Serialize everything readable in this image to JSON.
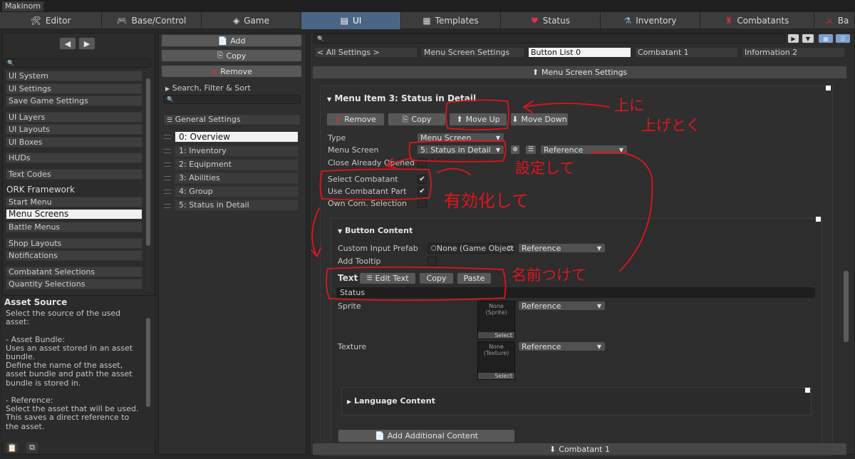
{
  "app": {
    "title": "Makinom"
  },
  "tabs": [
    {
      "label": "Editor",
      "icon": "wrench-icon"
    },
    {
      "label": "Base/Control",
      "icon": "gamepad-icon"
    },
    {
      "label": "Game",
      "icon": "cube-icon"
    },
    {
      "label": "UI",
      "icon": "ui-window-icon"
    },
    {
      "label": "Templates",
      "icon": "document-icon"
    },
    {
      "label": "Status",
      "icon": "heart-icon"
    },
    {
      "label": "Inventory",
      "icon": "potion-icon"
    },
    {
      "label": "Combatants",
      "icon": "warrior-icon"
    },
    {
      "label": "Ba",
      "icon": "swords-icon"
    }
  ],
  "sidebar": {
    "groups": [
      {
        "items": [
          "UI System",
          "UI Settings",
          "Save Game Settings"
        ]
      },
      {
        "items": [
          "UI Layers",
          "UI Layouts",
          "UI Boxes"
        ]
      },
      {
        "items": [
          "HUDs"
        ]
      },
      {
        "items": [
          "Text Codes"
        ]
      }
    ],
    "ork_header": "ORK Framework",
    "ork_items": [
      "Start Menu",
      "Menu Screens",
      "Battle Menus",
      "Shop Layouts",
      "Notifications",
      "Combatant Selections",
      "Quantity Selections"
    ],
    "selected": "Menu Screens"
  },
  "help": {
    "title": "Asset Source",
    "text": "Select the source of the used asset:\n\n- Asset Bundle:\nUses an asset stored in an asset bundle.\nDefine the name of the asset, asset bundle and path the asset bundle is stored in.\n\n- Reference:\nSelect the asset that will be used.\nThis saves a direct reference to the asset.\n\n- Resources:"
  },
  "middle": {
    "add": "Add",
    "copy": "Copy",
    "remove": "Remove",
    "search_filter": "Search, Filter & Sort",
    "general_settings": "General Settings",
    "items": [
      "0: Overview",
      "1: Inventory",
      "2: Equipment",
      "3: Abilities",
      "4: Group",
      "5: Status in Detail"
    ],
    "selected_index": 0
  },
  "breadcrumbs": [
    "< All Settings >",
    "Menu Screen Settings",
    "Button List 0",
    "Combatant 1",
    "Information 2"
  ],
  "menu_screen_settings": "Menu Screen Settings",
  "item": {
    "title": "Menu Item 3: Status in Detail",
    "remove": "Remove",
    "copy": "Copy",
    "move_up": "Move Up",
    "move_down": "Move Down",
    "type_label": "Type",
    "type_value": "Menu Screen",
    "menu_screen_label": "Menu Screen",
    "menu_screen_value": "5: Status in Detail",
    "reference_value": "Reference",
    "close_already_opened": "Close Already Opened",
    "select_combatant": "Select Combatant",
    "select_combatant_checked": true,
    "use_combatant_part": "Use Combatant Part",
    "use_combatant_part_checked": true,
    "own_com_selection": "Own Com. Selection"
  },
  "button_content": {
    "title": "Button Content",
    "custom_input_prefab": "Custom Input Prefab",
    "prefab_value": "None (Game Object",
    "reference": "Reference",
    "add_tooltip": "Add Tooltip",
    "text_label": "Text",
    "edit_text": "Edit Text",
    "copy": "Copy",
    "paste": "Paste",
    "text_value": "Status",
    "sprite_label": "Sprite",
    "sprite_none": "None",
    "sprite_type": "(Sprite)",
    "texture_label": "Texture",
    "texture_none": "None",
    "texture_type": "(Texture)",
    "select": "Select",
    "language_content": "Language Content",
    "add_additional_content": "Add Additional Content"
  },
  "footer": {
    "combatant": "Combatant 1"
  },
  "annotations": {
    "move_up_note_1": "上に",
    "move_up_note_2": "上げとく",
    "menu_screen_note": "設定して",
    "checkbox_note": "有効化して",
    "text_note": "名前つけて"
  },
  "colors": {
    "accent": "#4b6584",
    "annotation": "#e0141e",
    "background": "#282828"
  }
}
